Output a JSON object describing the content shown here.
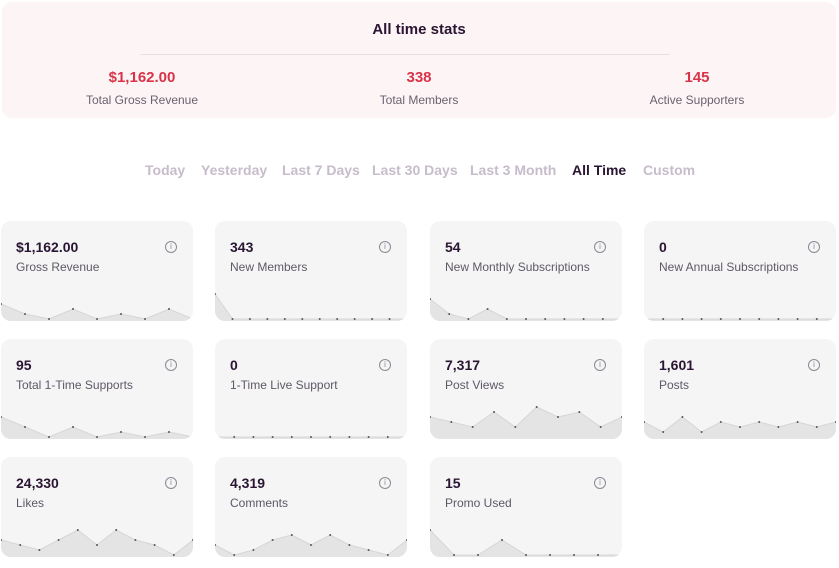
{
  "summary": {
    "title": "All time stats",
    "stats": [
      {
        "value": "$1,162.00",
        "label": "Total Gross Revenue"
      },
      {
        "value": "338",
        "label": "Total Members"
      },
      {
        "value": "145",
        "label": "Active Supporters"
      }
    ]
  },
  "tabs": [
    {
      "label": "Today"
    },
    {
      "label": "Yesterday"
    },
    {
      "label": "Last 7 Days"
    },
    {
      "label": "Last 30 Days"
    },
    {
      "label": "Last 3 Month"
    },
    {
      "label": "All Time",
      "active": true
    },
    {
      "label": "Custom"
    }
  ],
  "cards": [
    {
      "value": "$1,162.00",
      "label": "Gross Revenue",
      "trend": [
        3,
        1,
        0,
        2,
        0,
        1,
        0,
        2,
        0
      ]
    },
    {
      "value": "343",
      "label": "New Members",
      "trend": [
        5,
        0,
        0,
        0,
        0,
        0,
        0,
        0,
        0,
        0,
        0,
        0
      ]
    },
    {
      "value": "54",
      "label": "New Monthly Subscriptions",
      "trend": [
        4,
        1,
        0,
        2,
        0,
        0,
        0,
        0,
        0,
        0,
        0
      ]
    },
    {
      "value": "0",
      "label": "New Annual Subscriptions",
      "trend": [
        0,
        0,
        0,
        0,
        0,
        0,
        0,
        0,
        0,
        0,
        0
      ]
    },
    {
      "value": "95",
      "label": "Total 1-Time Supports",
      "trend": [
        4,
        2,
        0,
        2,
        0,
        1,
        0,
        1,
        0
      ]
    },
    {
      "value": "0",
      "label": "1-Time Live Support",
      "trend": [
        0,
        0,
        0,
        0,
        0,
        0,
        0,
        0,
        0,
        0,
        0
      ]
    },
    {
      "value": "7,317",
      "label": "Post Views",
      "trend": [
        4,
        3,
        2,
        5,
        2,
        6,
        4,
        5,
        2,
        4
      ]
    },
    {
      "value": "1,601",
      "label": "Posts",
      "trend": [
        3,
        1,
        4,
        1,
        3,
        2,
        3,
        2,
        3,
        2,
        3
      ]
    },
    {
      "value": "24,330",
      "label": "Likes",
      "trend": [
        3,
        2,
        1,
        3,
        5,
        2,
        5,
        3,
        2,
        0,
        3
      ]
    },
    {
      "value": "4,319",
      "label": "Comments",
      "trend": [
        2,
        0,
        1,
        3,
        4,
        2,
        4,
        2,
        1,
        0,
        3
      ]
    },
    {
      "value": "15",
      "label": "Promo Used",
      "trend": [
        5,
        0,
        0,
        3,
        0,
        0,
        0,
        0,
        0
      ]
    }
  ]
}
